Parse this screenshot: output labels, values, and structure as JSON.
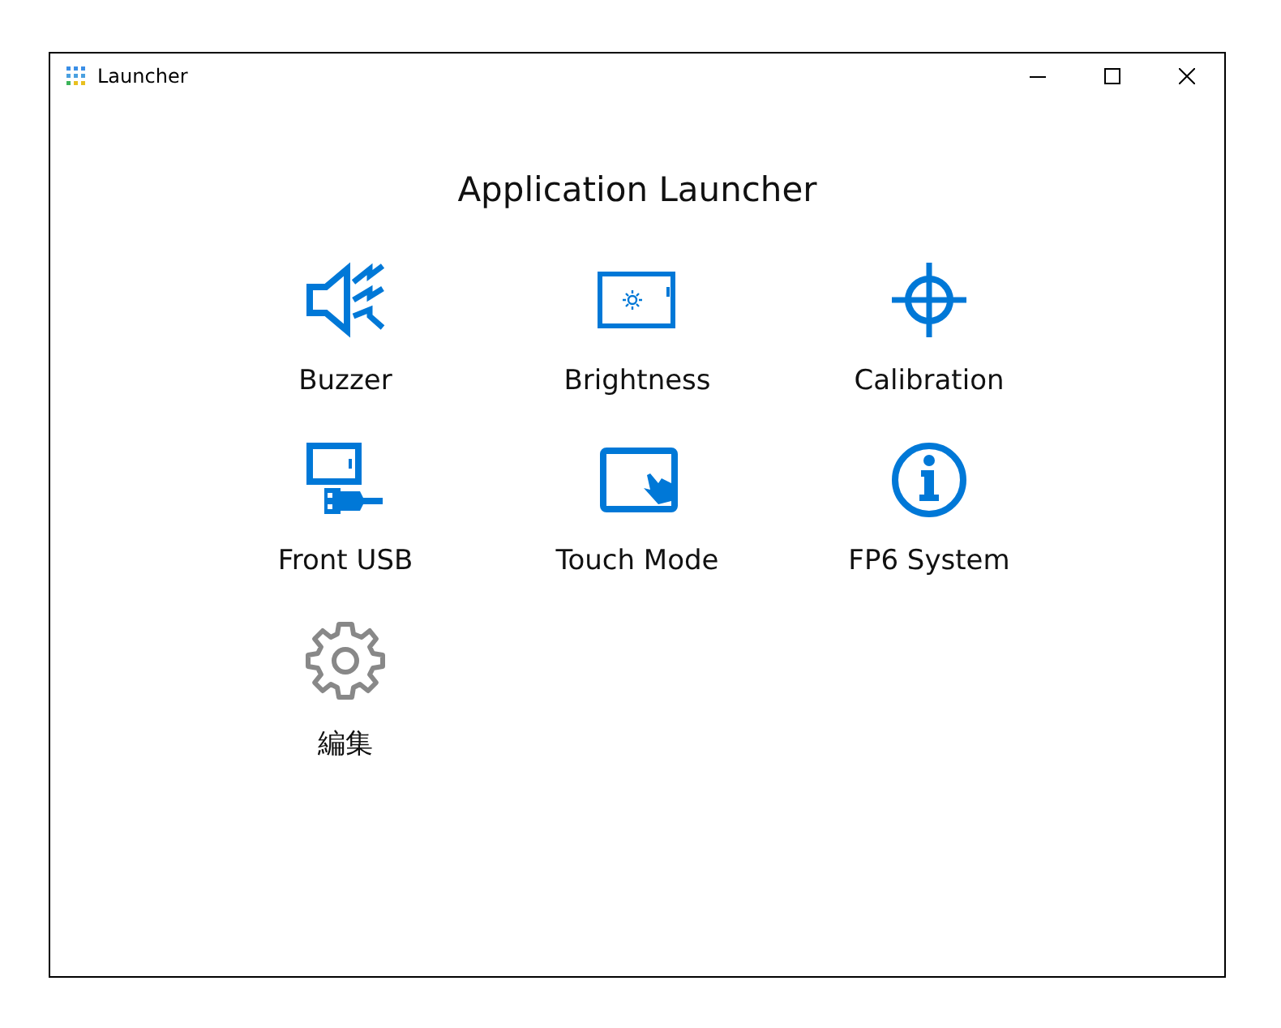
{
  "window": {
    "title": "Launcher"
  },
  "heading": "Application Launcher",
  "apps": [
    {
      "label": "Buzzer",
      "kind": "speaker"
    },
    {
      "label": "Brightness",
      "kind": "brightness"
    },
    {
      "label": "Calibration",
      "kind": "crosshair"
    },
    {
      "label": "Front USB",
      "kind": "usb"
    },
    {
      "label": "Touch Mode",
      "kind": "touch"
    },
    {
      "label": "FP6 System",
      "kind": "info"
    },
    {
      "label": "編集",
      "kind": "gear"
    }
  ]
}
